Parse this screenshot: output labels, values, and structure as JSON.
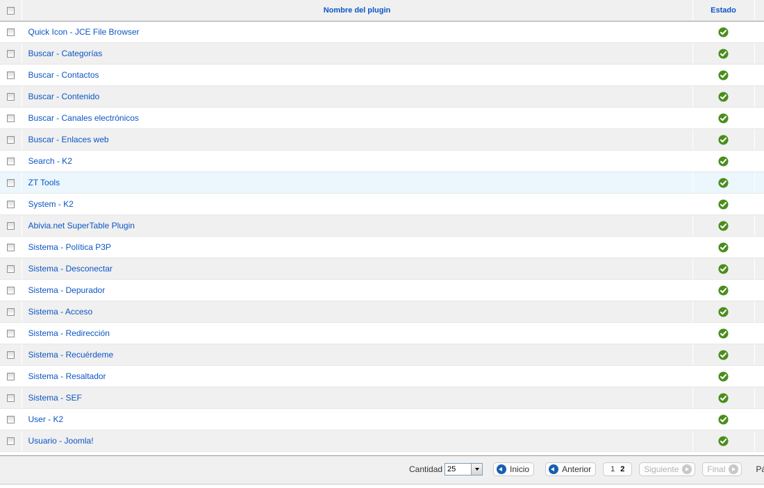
{
  "table": {
    "headers": {
      "name": "Nombre del plugin",
      "state": "Estado"
    },
    "hover_row_index": 7,
    "rows": [
      {
        "name": "Quick Icon - JCE File Browser",
        "enabled": true
      },
      {
        "name": "Buscar - Categorías",
        "enabled": true
      },
      {
        "name": "Buscar - Contactos",
        "enabled": true
      },
      {
        "name": "Buscar - Contenido",
        "enabled": true
      },
      {
        "name": "Buscar - Canales electrónicos",
        "enabled": true
      },
      {
        "name": "Buscar - Enlaces web",
        "enabled": true
      },
      {
        "name": "Search - K2",
        "enabled": true
      },
      {
        "name": "ZT Tools",
        "enabled": true
      },
      {
        "name": "System - K2",
        "enabled": true
      },
      {
        "name": "Abivia.net SuperTable Plugin",
        "enabled": true
      },
      {
        "name": "Sistema - Política P3P",
        "enabled": true
      },
      {
        "name": "Sistema - Desconectar",
        "enabled": true
      },
      {
        "name": "Sistema - Depurador",
        "enabled": true
      },
      {
        "name": "Sistema - Acceso",
        "enabled": true
      },
      {
        "name": "Sistema - Redirección",
        "enabled": true
      },
      {
        "name": "Sistema - Recuérdeme",
        "enabled": true
      },
      {
        "name": "Sistema - Resaltador",
        "enabled": true
      },
      {
        "name": "Sistema - SEF",
        "enabled": true
      },
      {
        "name": "User - K2",
        "enabled": true
      },
      {
        "name": "Usuario - Joomla!",
        "enabled": true
      }
    ]
  },
  "pagination": {
    "limit_label": "Cantidad",
    "limit_value": "25",
    "start_label": "Inicio",
    "prev_label": "Anterior",
    "pages": [
      "1",
      "2"
    ],
    "current_page": "2",
    "next_label": "Siguiente",
    "end_label": "Final",
    "page_info": "Pá"
  },
  "colors": {
    "link": "#0b55c4",
    "status_ok": "#4a8e1c",
    "header_bg": "#f0f0f0",
    "hover_row": "#ebf6fd"
  },
  "icons": {
    "status": "check-circle-icon",
    "prev": "arrow-left-circle-icon",
    "next": "arrow-right-circle-icon"
  }
}
